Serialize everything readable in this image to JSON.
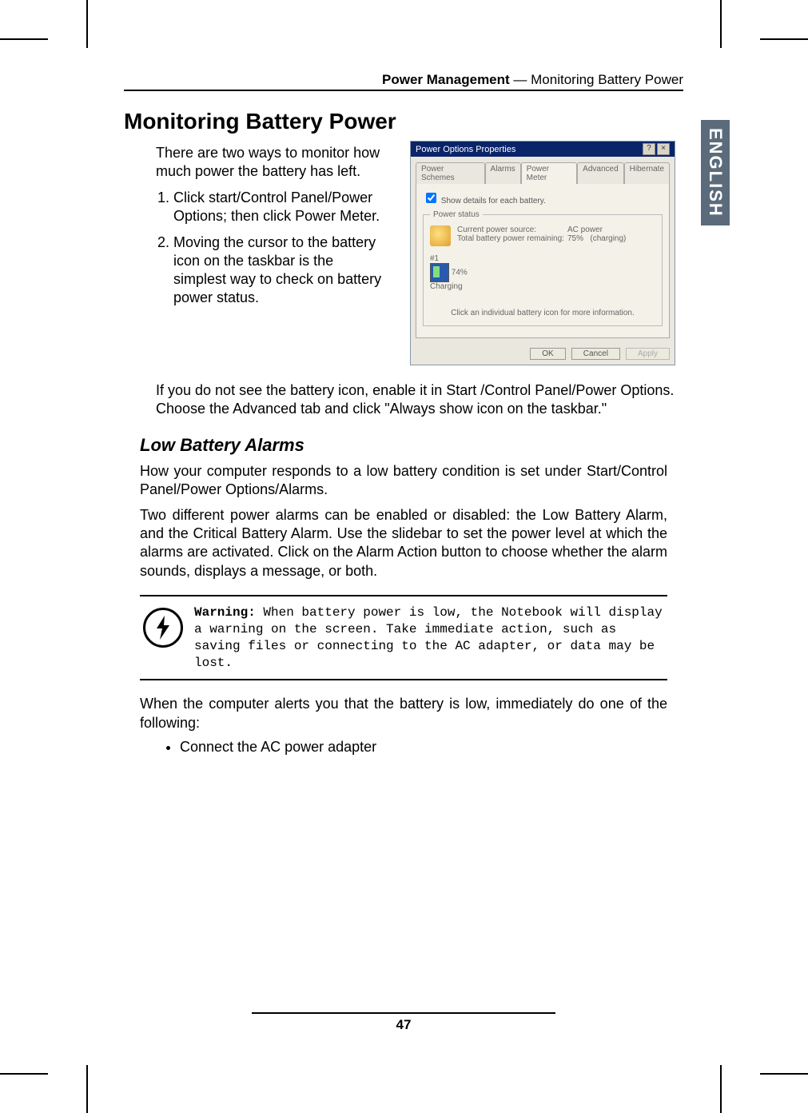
{
  "header": {
    "bold": "Power Management",
    "rest": " — Monitoring Battery Power"
  },
  "side_tab": "ENGLISH",
  "h1": "Monitoring Battery Power",
  "intro": "There are two ways to monitor how much power the battery has left.",
  "steps": [
    "Click start/Control Panel/Power Options; then click Power Meter.",
    "Moving the cursor to the battery icon on the taskbar is the simplest way to check on battery power status."
  ],
  "shot": {
    "title": "Power Options Properties",
    "tabs": [
      "Power Schemes",
      "Alarms",
      "Power Meter",
      "Advanced",
      "Hibernate"
    ],
    "checkbox": "Show details for each battery.",
    "legend": "Power status",
    "row1_label": "Current power source:",
    "row1_value": "AC power",
    "row2_label": "Total battery power remaining:",
    "row2_value": "75%",
    "row2_extra": "(charging)",
    "batt_num": "#1",
    "batt_pct": "74%",
    "batt_state": "Charging",
    "click_note": "Click an individual battery icon for more information.",
    "ok": "OK",
    "cancel": "Cancel",
    "apply": "Apply"
  },
  "after_shot": "If you do not see the battery icon, enable it in Start /Control Panel/Power Options. Choose the Advanced tab and click \"Always show icon on the taskbar.\"",
  "h2": "Low Battery Alarms",
  "p1": "How your computer responds to a low battery condition is set under Start/Control Panel/Power Options/Alarms.",
  "p2": "Two different power alarms can be enabled or disabled: the Low Battery Alarm, and the Critical Battery Alarm. Use the slidebar to set the power level at which the alarms are activated. Click on the Alarm Action button to choose whether the alarm sounds, displays a message, or both.",
  "warn_label": "Warning:",
  "warn_body": " When battery power is low, the Notebook will display a warning on the screen. Take immediate action, such as saving files or connecting to the AC adapter, or data may be lost.",
  "after_warn": "When the computer alerts you that the battery is low, immediately do one of the following:",
  "bullets": [
    "Connect the AC power adapter"
  ],
  "page_num": "47"
}
